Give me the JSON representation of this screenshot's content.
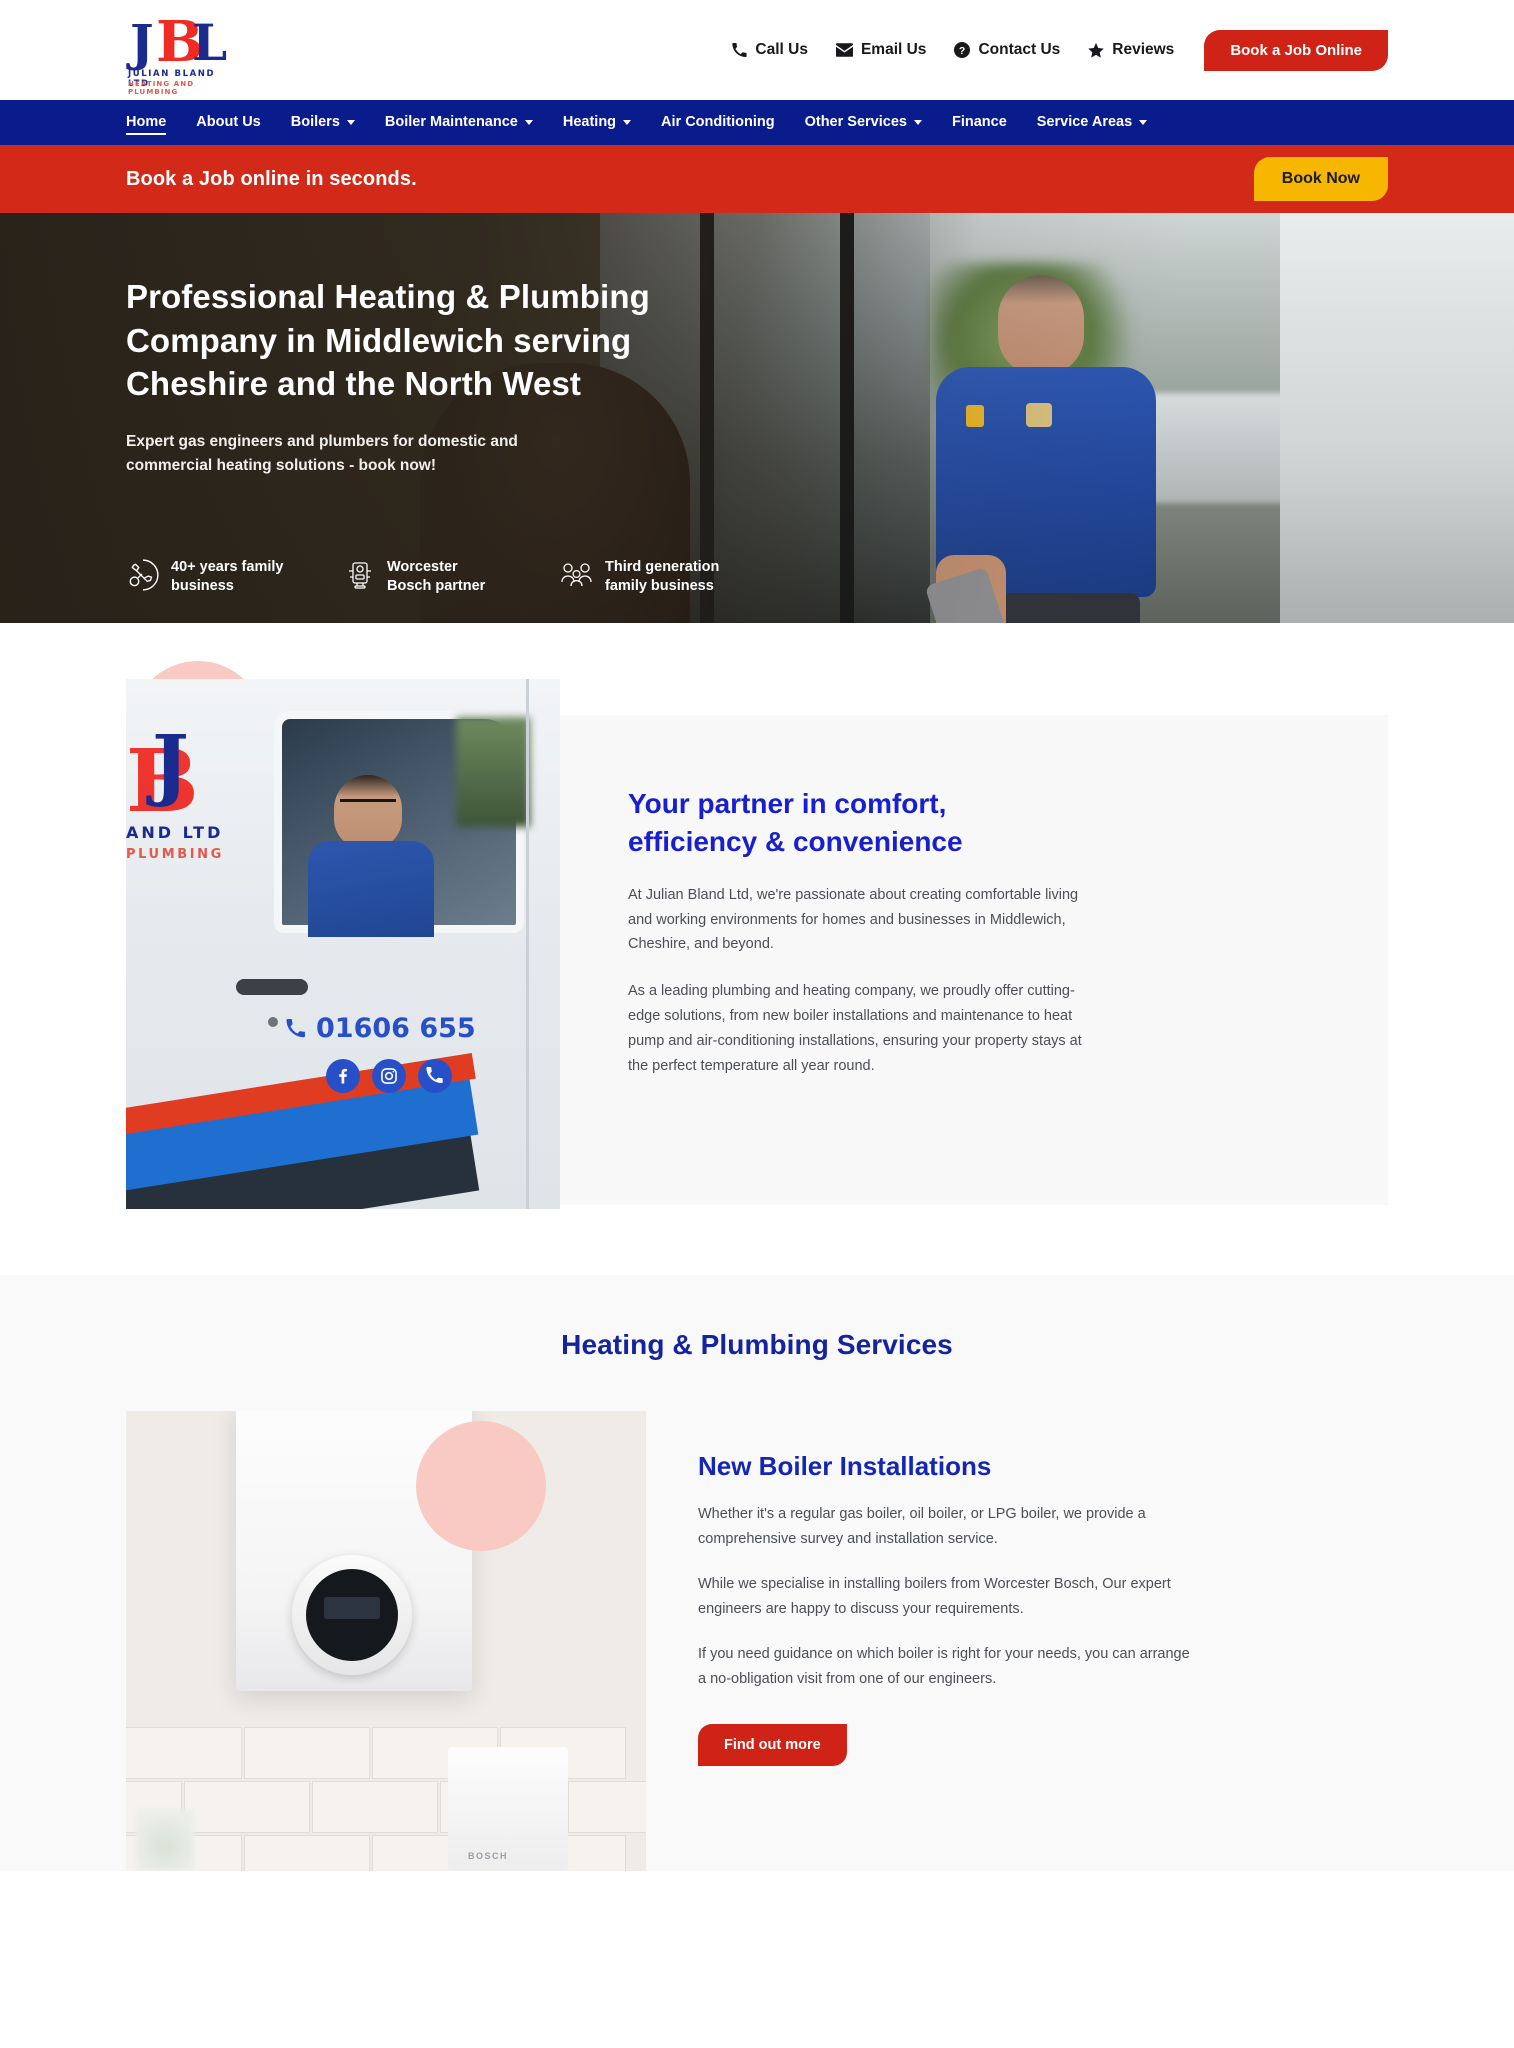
{
  "brand": {
    "logo_letters": [
      "J",
      "B",
      "L"
    ],
    "logo_line1": "JULIAN BLAND LTD",
    "logo_line2": "HEATING AND PLUMBING",
    "navy": "#0a1b8c",
    "red": "#cf2317",
    "yellow": "#f7b700",
    "pink_deco": "#f9c9c3"
  },
  "topbar": {
    "links": [
      {
        "label": "Call Us",
        "icon": "phone-icon"
      },
      {
        "label": "Email Us",
        "icon": "envelope-icon"
      },
      {
        "label": "Contact Us",
        "icon": "question-circle-icon"
      },
      {
        "label": "Reviews",
        "icon": "star-icon"
      }
    ],
    "cta_label": "Book a Job Online"
  },
  "nav": {
    "items": [
      {
        "label": "Home",
        "has_dropdown": false,
        "active": true
      },
      {
        "label": "About Us",
        "has_dropdown": false,
        "active": false
      },
      {
        "label": "Boilers",
        "has_dropdown": true,
        "active": false
      },
      {
        "label": "Boiler Maintenance",
        "has_dropdown": true,
        "active": false
      },
      {
        "label": "Heating",
        "has_dropdown": true,
        "active": false
      },
      {
        "label": "Air Conditioning",
        "has_dropdown": false,
        "active": false
      },
      {
        "label": "Other Services",
        "has_dropdown": true,
        "active": false
      },
      {
        "label": "Finance",
        "has_dropdown": false,
        "active": false
      },
      {
        "label": "Service Areas",
        "has_dropdown": true,
        "active": false
      }
    ]
  },
  "cta_strip": {
    "text": "Book a Job online in seconds.",
    "button_label": "Book Now"
  },
  "hero": {
    "title": "Professional Heating & Plumbing Company in Middlewich serving Cheshire and the North West",
    "subtitle": "Expert gas engineers and plumbers for domestic and commercial heating solutions - book now!",
    "badges": [
      {
        "icon": "handshake-tools-icon",
        "label": "40+ years family business"
      },
      {
        "icon": "boiler-icon",
        "label": "Worcester Bosch partner"
      },
      {
        "icon": "family-group-icon",
        "label": "Third generation family business"
      }
    ]
  },
  "partner": {
    "heading": "Your partner in comfort, efficiency & convenience",
    "paragraphs": [
      "At Julian Bland Ltd, we're passionate about creating comfortable living and working environments for homes and businesses in Middlewich, Cheshire, and beyond.",
      "As a leading plumbing and heating company, we proudly offer cutting-edge solutions, from new boiler installations and maintenance to heat pump and air-conditioning installations, ensuring your property stays at the perfect temperature all year round."
    ],
    "van": {
      "phone": "01606 655",
      "logo_letters": [
        "J",
        "B"
      ],
      "logo_line1": "AND LTD",
      "logo_line2": "PLUMBING",
      "socials": [
        "facebook-icon",
        "instagram-icon",
        "phone-icon"
      ]
    }
  },
  "services": {
    "heading": "Heating & Plumbing Services",
    "items": [
      {
        "title": "New Boiler Installations",
        "paragraphs": [
          "Whether it's a regular gas boiler, oil boiler, or LPG boiler, we provide a comprehensive survey and installation service.",
          "While we specialise in installing boilers from Worcester Bosch, Our expert engineers are happy to discuss your requirements.",
          "If you need guidance on which boiler is right for your needs, you can arrange a no-obligation visit from one of our engineers."
        ],
        "button_label": "Find out more",
        "image_caption": "BOSCH"
      }
    ]
  }
}
